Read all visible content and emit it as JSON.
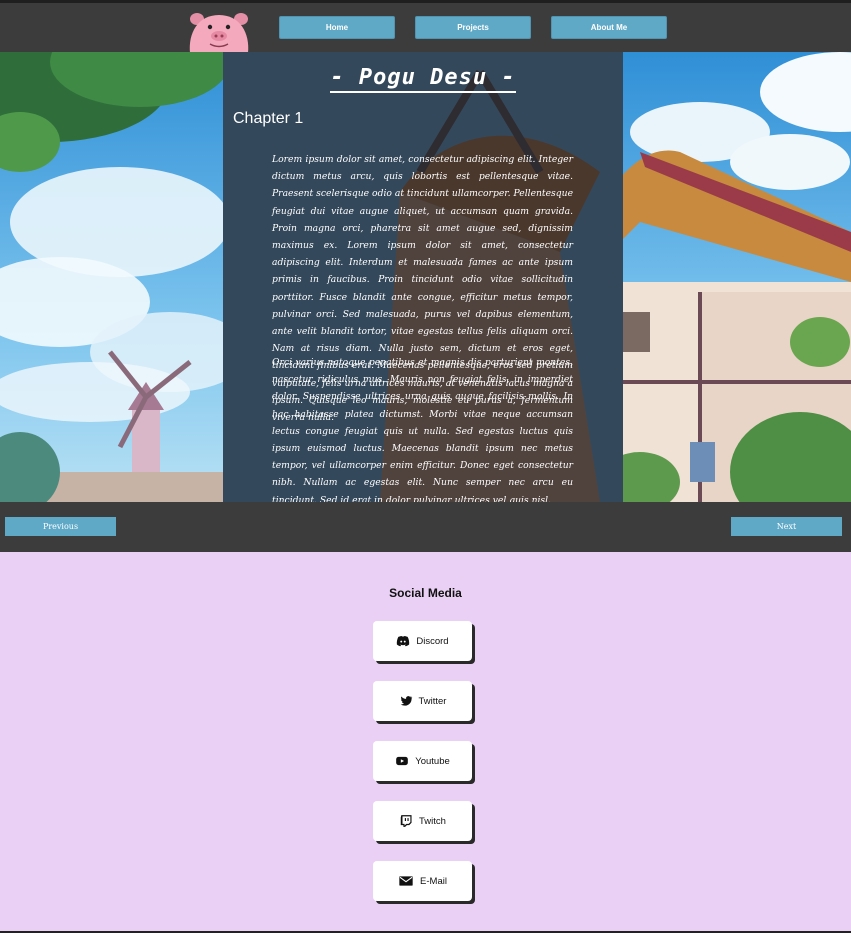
{
  "nav": {
    "items": [
      {
        "label": "Home"
      },
      {
        "label": "Projects"
      },
      {
        "label": "About Me"
      }
    ],
    "button_color": "#5fa9c7",
    "bar_color": "#3c3c3c",
    "logo_icon": "pig-logo-icon"
  },
  "story": {
    "title": "- Pogu Desu -",
    "chapter": "Chapter 1",
    "paragraphs": [
      "Lorem ipsum dolor sit amet, consectetur adipiscing elit. Integer dictum metus arcu, quis lobortis est pellentesque vitae. Praesent scelerisque odio at tincidunt ullamcorper. Pellentesque feugiat dui vitae augue aliquet, ut accumsan quam gravida. Proin magna orci, pharetra sit amet augue sed, dignissim maximus ex. Lorem ipsum dolor sit amet, consectetur adipiscing elit. Interdum et malesuada fames ac ante ipsum primis in faucibus. Proin tincidunt odio vitae sollicitudin porttitor. Fusce blandit ante congue, efficitur metus tempor, pulvinar orci. Sed malesuada, purus vel dapibus elementum, ante velit blandit tortor, vitae egestas tellus felis aliquam orci. Nam at risus diam. Nulla justo sem, dictum et eros eget, tincidunt finibus erat. Maecenas pellentesque, eros sed pretium vulputate, felis urna ultrices mauris, at venenatis lacus magna a ipsum. Quisque leo mauris, molestie eu purus a, fermentum viverra nulla.",
      "Orci varius natoque penatibus et magnis dis parturient montes, nascetur ridiculus mus. Mauris non feugiat felis, in imperdiet dolor. Suspendisse ultrices urna quis augue facilisis mollis. In hac habitasse platea dictumst. Morbi vitae neque accumsan lectus congue feugiat quis ut nulla. Sed egestas luctus quis ipsum euismod luctus. Maecenas blandit ipsum nec metus tempor, vel ullamcorper enim efficitur. Donec eget consectetur nibh. Nullam ac egestas elit. Nunc semper nec arcu eu tincidunt. Sed id erat in dolor pulvinar ultrices vel quis nisl."
    ]
  },
  "chapter_nav": {
    "previous": "Previous",
    "next": "Next"
  },
  "social": {
    "title": "Social Media",
    "links": [
      {
        "label": "Discord",
        "icon": "discord-icon"
      },
      {
        "label": "Twitter",
        "icon": "twitter-icon"
      },
      {
        "label": "Youtube",
        "icon": "youtube-icon"
      },
      {
        "label": "Twitch",
        "icon": "twitch-icon"
      },
      {
        "label": "E-Mail",
        "icon": "mail-icon"
      }
    ],
    "background_color": "#e9d0f4"
  }
}
